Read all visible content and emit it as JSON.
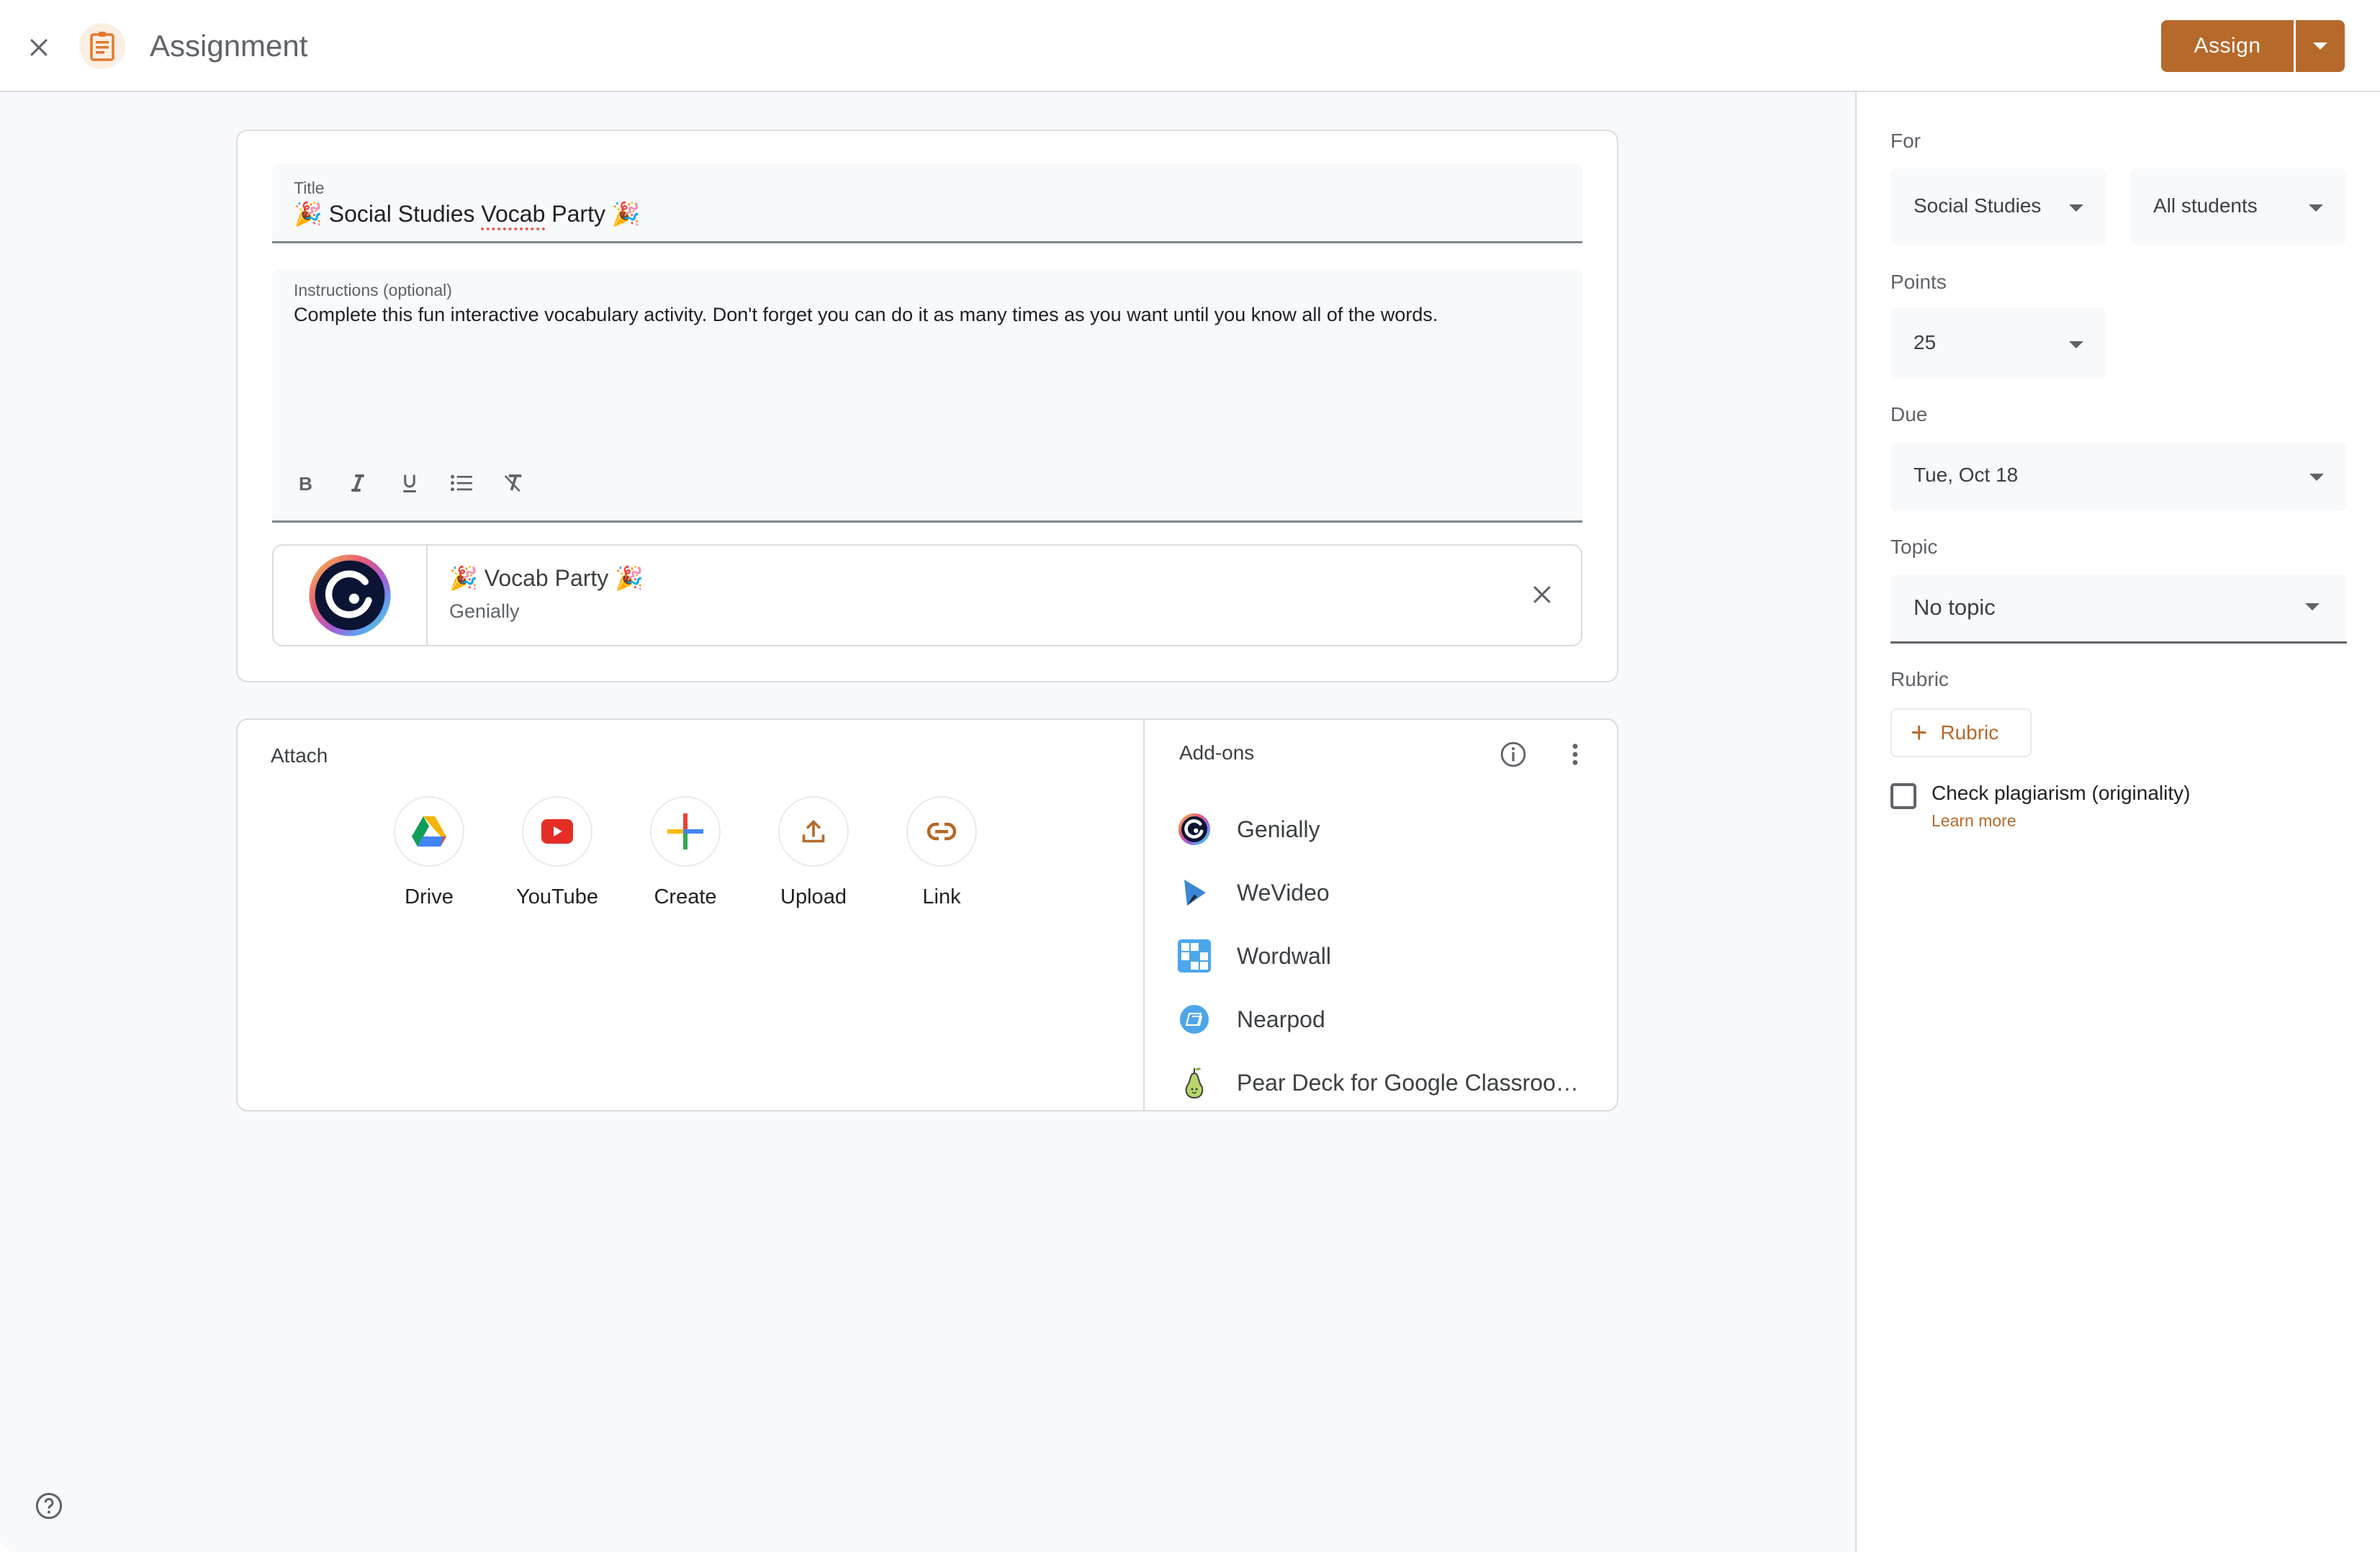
{
  "header": {
    "title": "Assignment",
    "close_icon": "close-icon",
    "assignment_icon": "clipboard-icon",
    "assign_label": "Assign",
    "assign_menu_icon": "caret-down-icon"
  },
  "colors": {
    "accent": "#b5692a",
    "accent_light": "#fbefe3",
    "background": "#f8f9fa",
    "border": "#dadce0"
  },
  "form": {
    "title": {
      "label": "Title",
      "value": "🎉 Social Studies Vocab Party 🎉",
      "value_parts": [
        "🎉 Social Studies ",
        "Vocab",
        " Party 🎉"
      ]
    },
    "instructions": {
      "label": "Instructions (optional)",
      "value": "Complete this fun interactive vocabulary activity. Don't forget you can do it as many times as you want until you know all of the words."
    },
    "formatting": [
      {
        "name": "bold",
        "icon": "bold-icon"
      },
      {
        "name": "italic",
        "icon": "italic-icon"
      },
      {
        "name": "underline",
        "icon": "underline-icon"
      },
      {
        "name": "bulleted-list",
        "icon": "bulleted-list-icon"
      },
      {
        "name": "clear-formatting",
        "icon": "clear-formatting-icon"
      }
    ],
    "attachment": {
      "title": "🎉 Vocab Party 🎉",
      "source": "Genially",
      "icon": "genially-logo-icon",
      "remove_icon": "close-icon"
    }
  },
  "attach": {
    "label": "Attach",
    "items": [
      {
        "label": "Drive",
        "icon": "google-drive-icon"
      },
      {
        "label": "YouTube",
        "icon": "youtube-icon"
      },
      {
        "label": "Create",
        "icon": "create-plus-icon"
      },
      {
        "label": "Upload",
        "icon": "upload-icon"
      },
      {
        "label": "Link",
        "icon": "link-icon"
      }
    ]
  },
  "addons": {
    "label": "Add-ons",
    "info_icon": "info-icon",
    "more_icon": "more-vert-icon",
    "items": [
      {
        "label": "Genially",
        "icon": "genially-icon"
      },
      {
        "label": "WeVideo",
        "icon": "wevideo-icon"
      },
      {
        "label": "Wordwall",
        "icon": "wordwall-icon"
      },
      {
        "label": "Nearpod",
        "icon": "nearpod-icon"
      },
      {
        "label": "Pear Deck for Google Classroo…",
        "icon": "pear-deck-icon"
      }
    ]
  },
  "settings": {
    "for_label": "For",
    "class_value": "Social Studies",
    "students_value": "All students",
    "points_label": "Points",
    "points_value": "25",
    "due_label": "Due",
    "due_value": "Tue, Oct 18",
    "topic_label": "Topic",
    "topic_value": "No topic",
    "rubric_label": "Rubric",
    "rubric_button": "Rubric",
    "plagiarism_label": "Check plagiarism (originality)",
    "plagiarism_checked": false,
    "learn_more": "Learn more"
  },
  "footer": {
    "help_icon": "help-icon"
  }
}
